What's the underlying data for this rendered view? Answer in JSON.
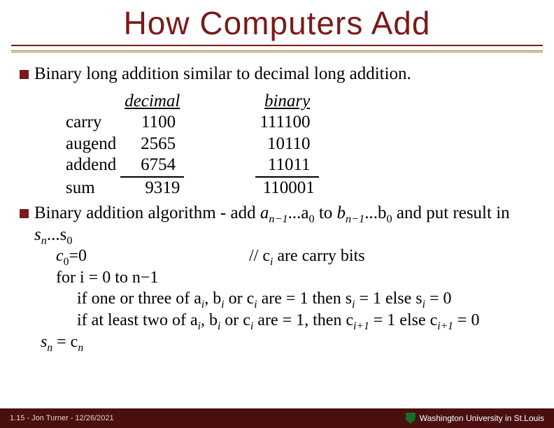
{
  "title": "How Computers Add",
  "bullets": {
    "b1": "Binary long addition similar to decimal long addition.",
    "b2_pre": "Binary addition algorithm - add ",
    "b2_mid1": " to ",
    "b2_mid2": " and put result in ",
    "a_seq": "...a",
    "b_seq": "...b",
    "s_seq": "...s",
    "an1": "a",
    "bn1": "b",
    "sn": "s",
    "nminus1": "n−1",
    "zero": "0",
    "n": "n"
  },
  "example": {
    "col_dec": "decimal",
    "col_bin": "binary",
    "row_carry": "carry",
    "row_augend": "augend",
    "row_addend": "addend",
    "row_sum": "sum",
    "dec": {
      "carry": "1100 ",
      "augend": "2565 ",
      "addend": "6754 ",
      "sum": "9319"
    },
    "bin": {
      "carry": "111100 ",
      "augend": "10110 ",
      "addend": "11011 ",
      "sum": "110001"
    }
  },
  "algo": {
    "l1a": "c",
    "l1b": "=0",
    "l1c": "// c",
    "l1d": " are carry bits",
    "l2": "for i = 0 to n−1",
    "l3a": "if one or three of a",
    "l3b": ", b",
    "l3c": " or c",
    "l3d": " are = 1 then s",
    "l3e": " = 1 else s",
    "l3f": " = 0",
    "l4a": "if at least two of a",
    "l4b": ", b",
    "l4c": " or c",
    "l4d": " are = 1, then c",
    "l4e": " = 1 else c",
    "l4f": " = 0",
    "l5a": "s",
    "l5b": " = c",
    "i": "i",
    "ip1": "i+1"
  },
  "footer": {
    "left": "1.15 - Jon Turner - 12/26/2021",
    "right": "Washington University in St.Louis"
  }
}
